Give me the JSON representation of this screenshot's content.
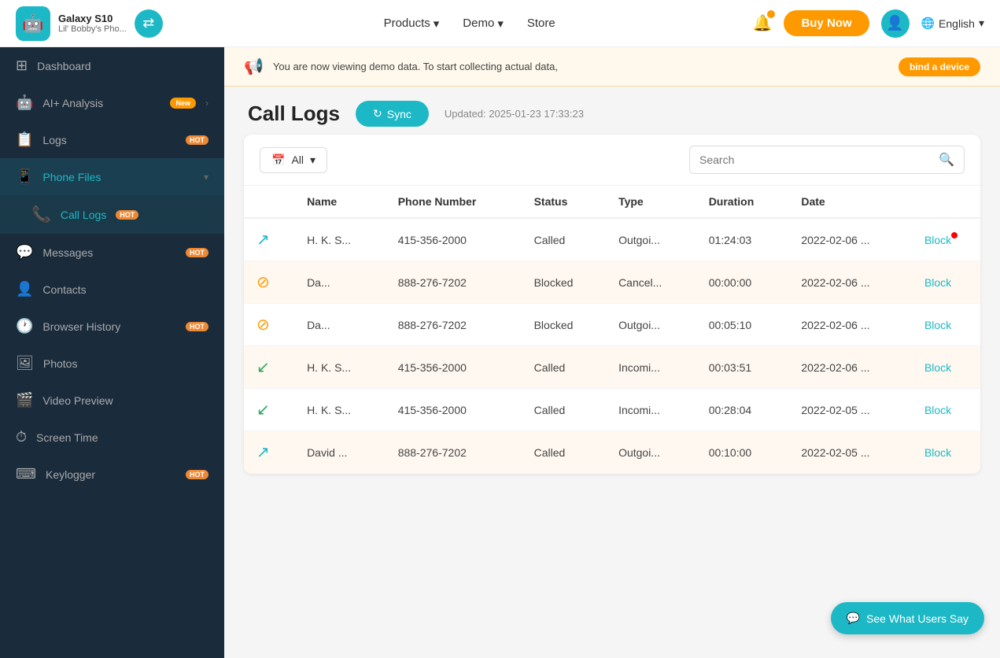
{
  "nav": {
    "device_name": "Galaxy S10",
    "device_sub": "Lil' Bobby's Pho...",
    "products_label": "Products",
    "demo_label": "Demo",
    "store_label": "Store",
    "buy_now_label": "Buy Now",
    "lang_label": "English"
  },
  "sidebar": {
    "dashboard_label": "Dashboard",
    "ai_analysis_label": "AI+ Analysis",
    "ai_analysis_badge": "New",
    "logs_label": "Logs",
    "phone_files_label": "Phone Files",
    "call_logs_label": "Call Logs",
    "messages_label": "Messages",
    "contacts_label": "Contacts",
    "browser_history_label": "Browser History",
    "photos_label": "Photos",
    "video_preview_label": "Video Preview",
    "screen_time_label": "Screen Time",
    "keylogger_label": "Keylogger"
  },
  "demo_banner": {
    "text": "You are now viewing demo data. To start collecting actual data,",
    "bind_btn": "bind a device"
  },
  "page": {
    "title": "Call Logs",
    "sync_label": "Sync",
    "updated_text": "Updated: 2025-01-23 17:33:23"
  },
  "table": {
    "filter_label": "All",
    "search_placeholder": "Search",
    "columns": [
      "Name",
      "Phone Number",
      "Status",
      "Type",
      "Duration",
      "Date"
    ],
    "rows": [
      {
        "icon_type": "outgoing",
        "name": "H. K. S...",
        "phone": "415-356-2000",
        "status": "Called",
        "type": "Outgoi...",
        "duration": "01:24:03",
        "date": "2022-02-06 ...",
        "has_dot": true
      },
      {
        "icon_type": "blocked",
        "name": "Da...",
        "phone": "888-276-7202",
        "status": "Blocked",
        "type": "Cancel...",
        "duration": "00:00:00",
        "date": "2022-02-06 ...",
        "has_dot": false
      },
      {
        "icon_type": "blocked",
        "name": "Da...",
        "phone": "888-276-7202",
        "status": "Blocked",
        "type": "Outgoi...",
        "duration": "00:05:10",
        "date": "2022-02-06 ...",
        "has_dot": false
      },
      {
        "icon_type": "incoming",
        "name": "H. K. S...",
        "phone": "415-356-2000",
        "status": "Called",
        "type": "Incomi...",
        "duration": "00:03:51",
        "date": "2022-02-06 ...",
        "has_dot": false
      },
      {
        "icon_type": "incoming",
        "name": "H. K. S...",
        "phone": "415-356-2000",
        "status": "Called",
        "type": "Incomi...",
        "duration": "00:28:04",
        "date": "2022-02-05 ...",
        "has_dot": false
      },
      {
        "icon_type": "outgoing",
        "name": "David ...",
        "phone": "888-276-7202",
        "status": "Called",
        "type": "Outgoi...",
        "duration": "00:10:00",
        "date": "2022-02-05 ...",
        "has_dot": false
      }
    ]
  },
  "feedback": {
    "label": "See What Users Say"
  }
}
